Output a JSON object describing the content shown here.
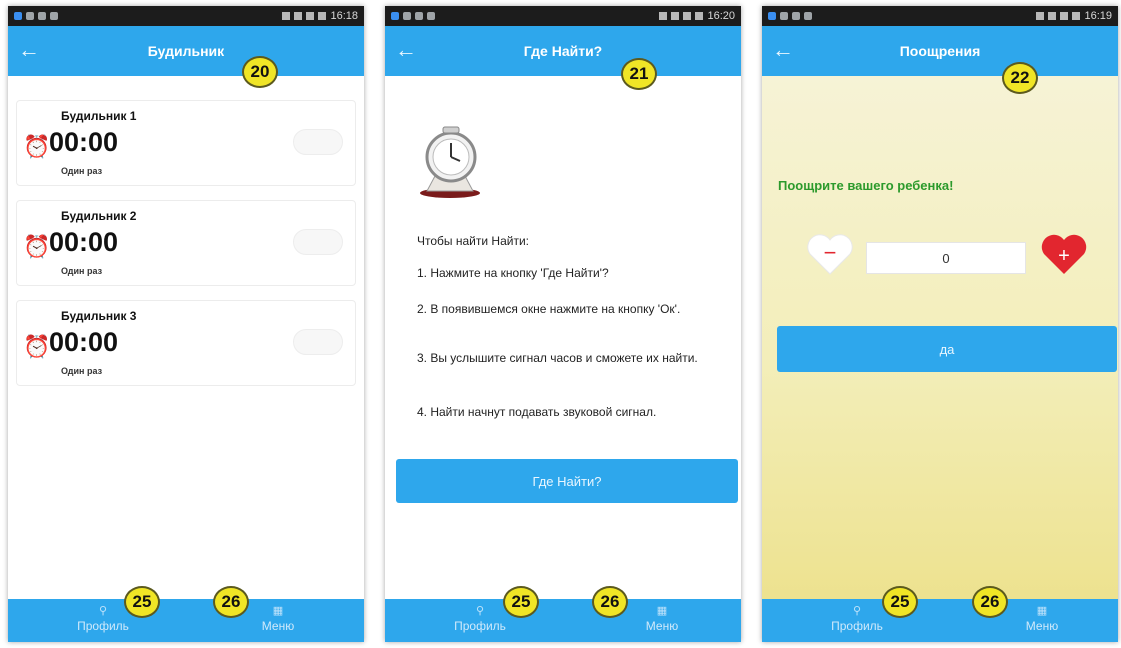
{
  "status_bars": [
    {
      "time": "16:18"
    },
    {
      "time": "16:20"
    },
    {
      "time": "16:19"
    }
  ],
  "screen1": {
    "title": "Будильник",
    "badge": "20",
    "alarms": [
      {
        "name": "Будильник 1",
        "time": "00:00",
        "repeat": "Один раз"
      },
      {
        "name": "Будильник 2",
        "time": "00:00",
        "repeat": "Один раз"
      },
      {
        "name": "Будильник 3",
        "time": "00:00",
        "repeat": "Один раз"
      }
    ]
  },
  "screen2": {
    "title": "Где Найти?",
    "badge": "21",
    "intro": "Чтобы найти Найти:",
    "steps": [
      "1. Нажмите на кнопку 'Где Найти'?",
      "2. В появившемся окне нажмите на кнопку 'Ок'.",
      "3. Вы услышите сигнал часов и сможете их найти.",
      "4. Найти начнут подавать звуковой сигнал."
    ],
    "button": "Где Найти?"
  },
  "screen3": {
    "title": "Поощрения",
    "badge": "22",
    "heading": "Поощрите вашего ребенка!",
    "minus": "−",
    "plus": "+",
    "counter_value": "0",
    "button": "да"
  },
  "bottom_nav": {
    "profile": "Профиль",
    "menu": "Меню",
    "badge_profile": "25",
    "badge_menu": "26"
  },
  "colors": {
    "accent": "#2ea7ec",
    "heading_green": "#2c9a2c",
    "heart_red": "#e2262f"
  }
}
